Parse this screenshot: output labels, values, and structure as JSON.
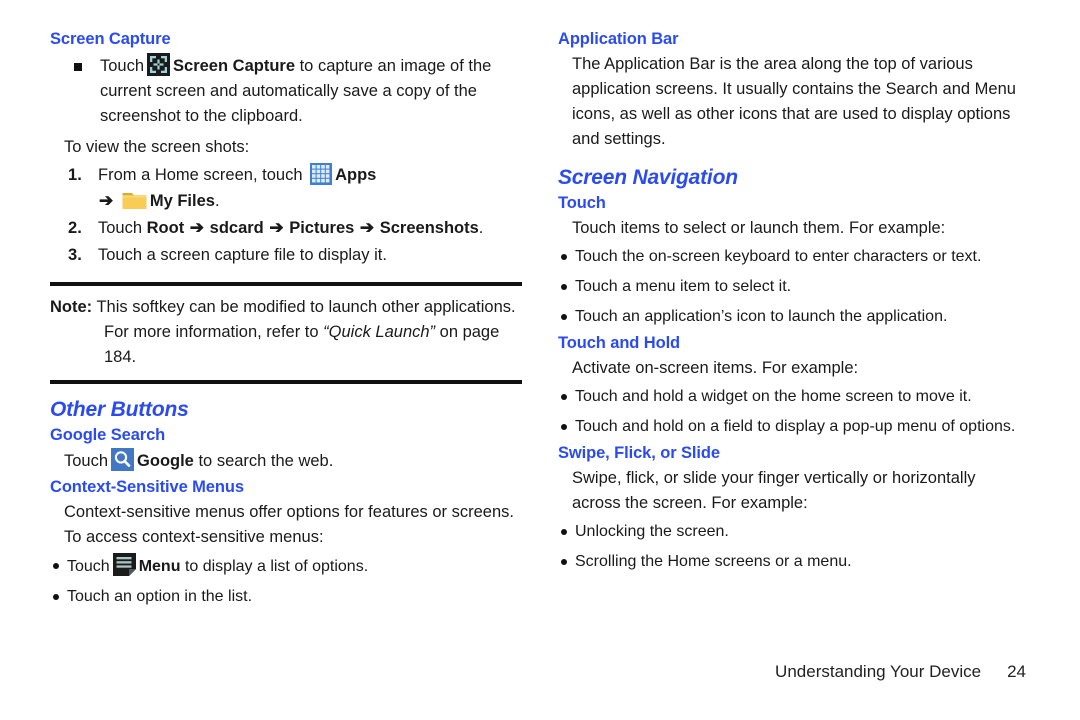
{
  "colors": {
    "heading_blue": "#2B4BF2",
    "body_black": "#1a1a1a",
    "apps_icon_blue": "#3F7FD0",
    "google_icon_blue": "#4277C4",
    "folder_yellow": "#F5C33B",
    "capture_icon_dark": "#1b1b1b"
  },
  "left_column": {
    "screen_capture": {
      "heading": "Screen Capture",
      "bullet_items": [
        {
          "text_before_icon": "Touch",
          "icon": "screen-capture-icon",
          "bold_label": "Screen Capture",
          "text_after": "to capture an image of the current screen and automatically save a copy of the screenshot to the clipboard."
        }
      ],
      "intro": "To view the screen shots:",
      "steps": [
        {
          "part1": "From a Home screen, touch",
          "icon1": "apps-grid-icon",
          "bold1": "Apps",
          "arrow": "➔",
          "icon2": "folder-icon",
          "bold2": "My Files",
          "period": "."
        },
        {
          "prefix": "Touch",
          "path": [
            "Root",
            "sdcard",
            "Pictures",
            "Screenshots"
          ],
          "separator": "➔",
          "period": "."
        },
        {
          "text": "Touch a screen capture file to display it."
        }
      ]
    },
    "note": {
      "label": "Note:",
      "text_part1": "This softkey can be modified to launch other applications. For more information, refer to ",
      "italic_ref": "“Quick Launch”",
      "text_part2": " on page 184."
    },
    "other_buttons": {
      "heading": "Other Buttons",
      "google_search": {
        "heading": "Google Search",
        "text_before_icon": "Touch",
        "icon": "google-search-icon",
        "bold_label": "Google",
        "text_after": "to search the web."
      },
      "context_menus": {
        "heading": "Context-Sensitive Menus",
        "body": "Context-sensitive menus offer options for features or screens. To access context-sensitive menus:",
        "bullets": [
          {
            "text_before_icon": "Touch",
            "icon": "menu-icon",
            "bold_label": "Menu",
            "text_after": "to display a list of options."
          },
          {
            "text": "Touch an option in the list."
          }
        ]
      }
    }
  },
  "right_column": {
    "application_bar": {
      "heading": "Application Bar",
      "body": "The Application Bar is the area along the top of various application screens. It usually contains the Search and Menu icons, as well as other icons that are used to display options and settings."
    },
    "screen_navigation": {
      "heading": "Screen Navigation",
      "touch": {
        "heading": "Touch",
        "body": "Touch items to select or launch them. For example:",
        "bullets": [
          "Touch the on-screen keyboard to enter characters or text.",
          "Touch a menu item to select it.",
          "Touch an application’s icon to launch the application."
        ]
      },
      "touch_and_hold": {
        "heading": "Touch and Hold",
        "body": "Activate on-screen items. For example:",
        "bullets": [
          "Touch and hold a widget on the home screen to move it.",
          "Touch and hold on a field to display a pop-up menu of options."
        ]
      },
      "swipe": {
        "heading": "Swipe, Flick, or Slide",
        "body": "Swipe, flick, or slide your finger vertically or horizontally across the screen. For example:",
        "bullets": [
          "Unlocking the screen.",
          "Scrolling the Home screens or a menu."
        ]
      }
    }
  },
  "footer": {
    "chapter": "Understanding Your Device",
    "page_number": "24"
  }
}
